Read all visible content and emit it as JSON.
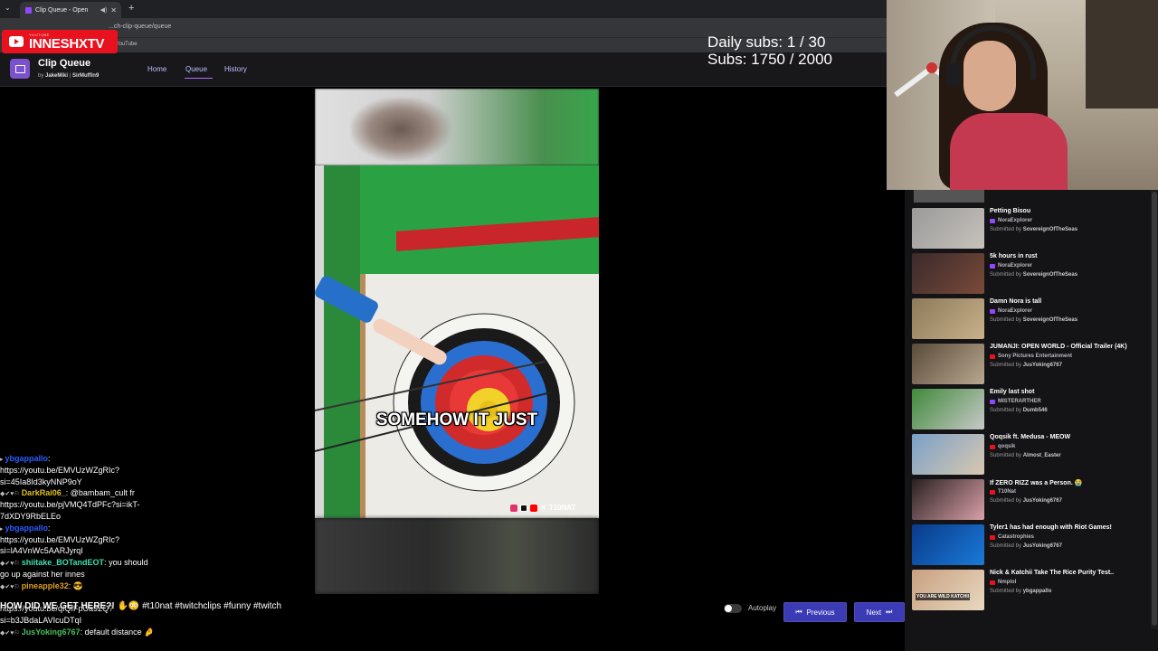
{
  "browser": {
    "tab_title": "Clip Queue - Open",
    "url": "...ch-clip-queue/queue",
    "bookmark_label": "YouTube"
  },
  "overlay": {
    "yt_small": "YOUTUBE",
    "yt_channel": "INNESHXTV",
    "daily_subs": "Daily subs: 1 / 30",
    "subs": "Subs: 1750 / 2000"
  },
  "app": {
    "title": "Clip Queue",
    "by_prefix": "by",
    "author1": "JakeMiki",
    "separator": "|",
    "author2": "SirMuffin9",
    "nav": {
      "home": "Home",
      "queue": "Queue",
      "history": "History"
    }
  },
  "player": {
    "caption": "SOMEHOW IT JUST",
    "watermark": "T10NAT"
  },
  "controls": {
    "autoplay": "Autoplay",
    "previous": "Previous",
    "next": "Next"
  },
  "queue": [
    {
      "title": "Petting Bisou",
      "channel": "NoraExplorer",
      "platform": "twitch",
      "submitted_prefix": "Submitted by",
      "submitter": "SovereignOfTheSeas",
      "thumb": [
        "#9a9a9a",
        "#c7c2bb"
      ]
    },
    {
      "title": "5k hours in rust",
      "channel": "NoraExplorer",
      "platform": "twitch",
      "submitted_prefix": "Submitted by",
      "submitter": "SovereignOfTheSeas",
      "thumb": [
        "#3a2a2a",
        "#7a4a3a"
      ]
    },
    {
      "title": "Damn Nora is tall",
      "channel": "NoraExplorer",
      "platform": "twitch",
      "submitted_prefix": "Submitted by",
      "submitter": "SovereignOfTheSeas",
      "thumb": [
        "#8c7a5a",
        "#c9b08a"
      ]
    },
    {
      "title": "JUMANJI: OPEN WORLD - Official Trailer (4K)",
      "channel": "Sony Pictures Entertainment",
      "platform": "youtube",
      "submitted_prefix": "Submitted by",
      "submitter": "JusYoking6767",
      "thumb": [
        "#5a4a3a",
        "#b8a890"
      ]
    },
    {
      "title": "Emily last shot",
      "channel": "MISTERARTHER",
      "platform": "twitch",
      "submitted_prefix": "Submitted by",
      "submitter": "Dumb546",
      "thumb": [
        "#3f8a3a",
        "#c8c8c8"
      ]
    },
    {
      "title": "Qoqsik ft. Medusa - MEOW",
      "channel": "qoqsik",
      "platform": "youtube",
      "submitted_prefix": "Submitted by",
      "submitter": "Almost_Easter",
      "thumb": [
        "#7aa0c8",
        "#d8c8b0"
      ]
    },
    {
      "title": "If ZERO RIZZ was a Person. 😭",
      "channel": "T10Nat",
      "platform": "youtube",
      "submitted_prefix": "Submitted by",
      "submitter": "JusYoking6767",
      "thumb": [
        "#2a2020",
        "#d8a0a8"
      ]
    },
    {
      "title": "Tyler1 has had enough with Riot Games!",
      "channel": "Catastrophies",
      "platform": "youtube",
      "submitted_prefix": "Submitted by",
      "submitter": "JusYoking6767",
      "thumb": [
        "#0a3a8a",
        "#1a7ad8"
      ]
    },
    {
      "title": "Nick & Katchii Take The Rice Purity Test..",
      "channel": "Nmplol",
      "platform": "youtube",
      "submitted_prefix": "Submitted by",
      "submitter": "ybgappallo",
      "thumb": [
        "#c8a080",
        "#e8d8c0"
      ],
      "thumb_text": "YOU ARE WILD KATCHII"
    }
  ],
  "chat": [
    {
      "badges": "▸",
      "user": "ybgappallo",
      "user_color": "#2a5cff",
      "sep": ":",
      "text": ""
    },
    {
      "badges": "",
      "user": "",
      "user_color": "#fff",
      "sep": "",
      "text": "https://youtu.be/EMVUzWZgRIc?"
    },
    {
      "badges": "",
      "user": "",
      "user_color": "#fff",
      "sep": "",
      "text": "si=45Ia8Id3kyNNP9oY"
    },
    {
      "badges": "◆✔♥⚐",
      "user": "DarkRai06_",
      "user_color": "#e0c020",
      "sep": ":",
      "text": " @bambam_cult fr"
    },
    {
      "badges": "",
      "user": "",
      "user_color": "#fff",
      "sep": "",
      "text": "https://youtu.be/pjVMQ4TdPFc?si=ikT-"
    },
    {
      "badges": "",
      "user": "",
      "user_color": "#fff",
      "sep": "",
      "text": "7dXDY9RbELEo"
    },
    {
      "badges": "▸",
      "user": "ybgappallo",
      "user_color": "#2a5cff",
      "sep": ":",
      "text": ""
    },
    {
      "badges": "",
      "user": "",
      "user_color": "#fff",
      "sep": "",
      "text": "https://youtu.be/EMVUzWZgRIc?"
    },
    {
      "badges": "",
      "user": "",
      "user_color": "#fff",
      "sep": "",
      "text": "si=lA4VnWc5AARJyrqI"
    },
    {
      "badges": "◆✔♥⚐",
      "user": "shiitake_BOTandEOT",
      "user_color": "#3fe0b0",
      "sep": ":",
      "text": " you should"
    },
    {
      "badges": "",
      "user": "",
      "user_color": "#fff",
      "sep": "",
      "text": "go up against her innes"
    },
    {
      "badges": "◆✔♥⚐",
      "user": "pineapple32",
      "user_color": "#e0a020",
      "sep": ":",
      "text": " 😎"
    },
    {
      "badges": "",
      "user": "",
      "user_color": "#fff",
      "sep": "",
      "text": ""
    },
    {
      "badges": "",
      "user": "",
      "user_color": "#fff",
      "sep": "",
      "text": "https://youtu.be/qIQfFpUa92Q?"
    },
    {
      "badges": "",
      "user": "",
      "user_color": "#fff",
      "sep": "",
      "text": "si=b3JBdaLAVIcuDTqI"
    },
    {
      "badges": "◆✔♥⚐",
      "user": "JusYoking6767",
      "user_color": "#4ac060",
      "sep": ":",
      "text": " default distance 🤌"
    }
  ],
  "bottom_caption": {
    "main": "HOW DID WE GET HERE?! ✋😳 ",
    "tags": "#t10nat #twitchclips #funny #twitch"
  },
  "colors": {
    "accent": "#9146ff",
    "button": "#3b3bb5",
    "youtube_red": "#e8111e",
    "twitch_purple": "#9146ff"
  }
}
